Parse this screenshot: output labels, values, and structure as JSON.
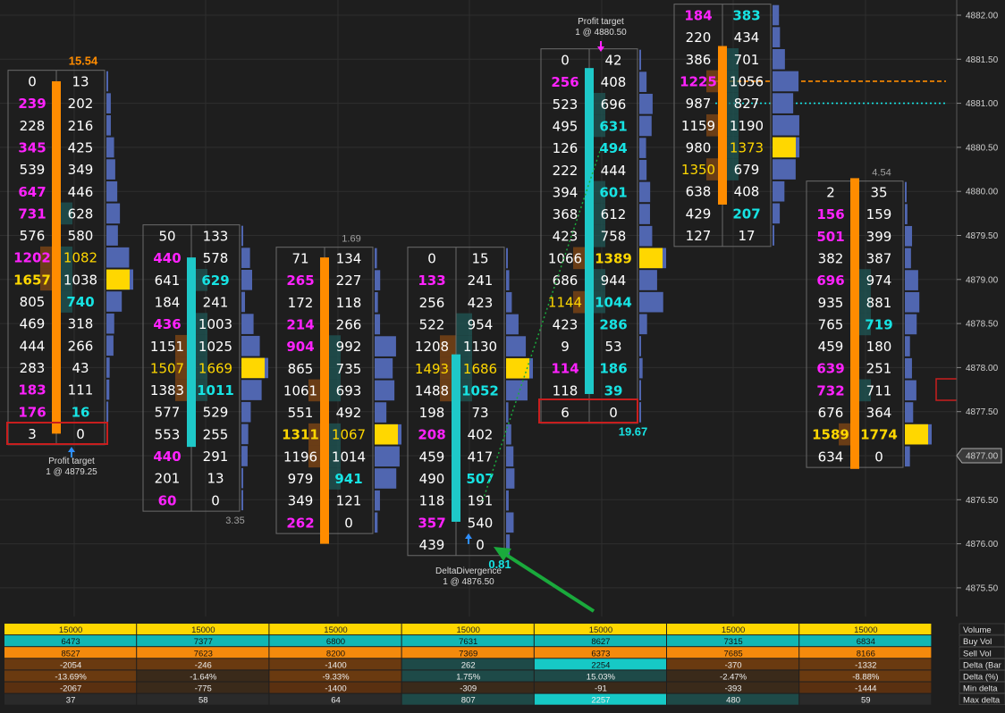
{
  "colors": {
    "background": "#1e1e1e",
    "grid": "#2e2e2e",
    "cell_border": "#6b6b6b",
    "bid_strong": "#ff22ff",
    "ask_strong": "#17e3e3",
    "poc_yellow": "#ffd700",
    "bar_orange": "#ff8c00",
    "bar_cyan": "#1ec8c8",
    "profile_blue": "#5066b0",
    "heat_orange": "#8a4a12",
    "heat_teal": "#1e5a58",
    "profit_box": "#c81e1e",
    "arrow_green": "#1aaa3c",
    "annotation_blue": "#2f8fff"
  },
  "chart_data": {
    "type": "table",
    "title": "Footprint",
    "y_axis": {
      "price_range": [
        4875.25,
        4882.0
      ],
      "tick_step": 0.5,
      "tick_labels": [
        "4882.00",
        "4881.50",
        "4881.00",
        "4880.50",
        "4880.00",
        "4879.50",
        "4879.00",
        "4878.50",
        "4878.00",
        "4877.50",
        "4877.00",
        "4876.50",
        "4876.00",
        "4875.50"
      ],
      "current_price_label": "4877.00"
    },
    "candles": [
      {
        "top_label": "15.54",
        "top_label_color": "#ff8c00",
        "bottom_label": "",
        "bar_color": "orange",
        "bar_range": [
          4877.25,
          4881.25
        ],
        "rows": [
          {
            "bid": "0",
            "ask": "13",
            "bid_c": "w",
            "ask_c": "w"
          },
          {
            "bid": "239",
            "ask": "202",
            "bid_c": "m",
            "ask_c": "w"
          },
          {
            "bid": "228",
            "ask": "216",
            "bid_c": "w",
            "ask_c": "w"
          },
          {
            "bid": "345",
            "ask": "425",
            "bid_c": "m",
            "ask_c": "w"
          },
          {
            "bid": "539",
            "ask": "349",
            "bid_c": "w",
            "ask_c": "w"
          },
          {
            "bid": "647",
            "ask": "446",
            "bid_c": "m",
            "ask_c": "w"
          },
          {
            "bid": "731",
            "ask": "628",
            "bid_c": "m",
            "ask_c": "w"
          },
          {
            "bid": "576",
            "ask": "580",
            "bid_c": "w",
            "ask_c": "w"
          },
          {
            "bid": "1202",
            "ask": "1082",
            "bid_c": "m",
            "ask_c": "y"
          },
          {
            "bid": "1657",
            "ask": "1038",
            "bid_c": "yb",
            "ask_c": "w"
          },
          {
            "bid": "805",
            "ask": "740",
            "bid_c": "w",
            "ask_c": "c"
          },
          {
            "bid": "469",
            "ask": "318",
            "bid_c": "w",
            "ask_c": "w"
          },
          {
            "bid": "444",
            "ask": "266",
            "bid_c": "w",
            "ask_c": "w"
          },
          {
            "bid": "283",
            "ask": "43",
            "bid_c": "w",
            "ask_c": "w"
          },
          {
            "bid": "183",
            "ask": "111",
            "bid_c": "m",
            "ask_c": "w"
          },
          {
            "bid": "176",
            "ask": "16",
            "bid_c": "m",
            "ask_c": "c"
          },
          {
            "bid": "3",
            "ask": "0",
            "bid_c": "w",
            "ask_c": "w"
          }
        ]
      },
      {
        "top_label": "",
        "top_label_color": "#a0a0a0",
        "bottom_label": "3.35",
        "bar_color": "cyan",
        "bar_range": [
          4877.1,
          4879.25
        ],
        "rows": [
          {
            "bid": "50",
            "ask": "133",
            "bid_c": "w",
            "ask_c": "w"
          },
          {
            "bid": "440",
            "ask": "578",
            "bid_c": "m",
            "ask_c": "w"
          },
          {
            "bid": "641",
            "ask": "629",
            "bid_c": "w",
            "ask_c": "c"
          },
          {
            "bid": "184",
            "ask": "241",
            "bid_c": "w",
            "ask_c": "w"
          },
          {
            "bid": "436",
            "ask": "1003",
            "bid_c": "m",
            "ask_c": "w"
          },
          {
            "bid": "1151",
            "ask": "1025",
            "bid_c": "w",
            "ask_c": "w"
          },
          {
            "bid": "1507",
            "ask": "1669",
            "bid_c": "y",
            "ask_c": "y"
          },
          {
            "bid": "1383",
            "ask": "1011",
            "bid_c": "w",
            "ask_c": "c"
          },
          {
            "bid": "577",
            "ask": "529",
            "bid_c": "w",
            "ask_c": "w"
          },
          {
            "bid": "553",
            "ask": "255",
            "bid_c": "w",
            "ask_c": "w"
          },
          {
            "bid": "440",
            "ask": "291",
            "bid_c": "m",
            "ask_c": "w"
          },
          {
            "bid": "201",
            "ask": "13",
            "bid_c": "w",
            "ask_c": "w"
          },
          {
            "bid": "60",
            "ask": "0",
            "bid_c": "m",
            "ask_c": "w"
          }
        ]
      },
      {
        "top_label": "1.69",
        "top_label_color": "#a0a0a0",
        "bottom_label": "",
        "bar_color": "orange",
        "bar_range": [
          4876.0,
          4879.25
        ],
        "rows": [
          {
            "bid": "71",
            "ask": "134",
            "bid_c": "w",
            "ask_c": "w"
          },
          {
            "bid": "265",
            "ask": "227",
            "bid_c": "m",
            "ask_c": "w"
          },
          {
            "bid": "172",
            "ask": "118",
            "bid_c": "w",
            "ask_c": "w"
          },
          {
            "bid": "214",
            "ask": "266",
            "bid_c": "m",
            "ask_c": "w"
          },
          {
            "bid": "904",
            "ask": "992",
            "bid_c": "m",
            "ask_c": "w"
          },
          {
            "bid": "865",
            "ask": "735",
            "bid_c": "w",
            "ask_c": "w"
          },
          {
            "bid": "1061",
            "ask": "693",
            "bid_c": "w",
            "ask_c": "w"
          },
          {
            "bid": "551",
            "ask": "492",
            "bid_c": "w",
            "ask_c": "w"
          },
          {
            "bid": "1311",
            "ask": "1067",
            "bid_c": "yb",
            "ask_c": "y"
          },
          {
            "bid": "1196",
            "ask": "1014",
            "bid_c": "w",
            "ask_c": "w"
          },
          {
            "bid": "979",
            "ask": "941",
            "bid_c": "w",
            "ask_c": "c"
          },
          {
            "bid": "349",
            "ask": "121",
            "bid_c": "w",
            "ask_c": "w"
          },
          {
            "bid": "262",
            "ask": "0",
            "bid_c": "m",
            "ask_c": "w"
          }
        ]
      },
      {
        "top_label": "",
        "top_label_color": "#a0a0a0",
        "bottom_label": "0.81",
        "bar_color": "cyan",
        "bar_range": [
          4876.25,
          4878.15
        ],
        "rows": [
          {
            "bid": "0",
            "ask": "15",
            "bid_c": "w",
            "ask_c": "w"
          },
          {
            "bid": "133",
            "ask": "241",
            "bid_c": "m",
            "ask_c": "w"
          },
          {
            "bid": "256",
            "ask": "423",
            "bid_c": "w",
            "ask_c": "w"
          },
          {
            "bid": "522",
            "ask": "954",
            "bid_c": "w",
            "ask_c": "w"
          },
          {
            "bid": "1208",
            "ask": "1130",
            "bid_c": "w",
            "ask_c": "w"
          },
          {
            "bid": "1493",
            "ask": "1686",
            "bid_c": "y",
            "ask_c": "y"
          },
          {
            "bid": "1488",
            "ask": "1052",
            "bid_c": "w",
            "ask_c": "c"
          },
          {
            "bid": "198",
            "ask": "73",
            "bid_c": "w",
            "ask_c": "w"
          },
          {
            "bid": "208",
            "ask": "402",
            "bid_c": "m",
            "ask_c": "w"
          },
          {
            "bid": "459",
            "ask": "417",
            "bid_c": "w",
            "ask_c": "w"
          },
          {
            "bid": "490",
            "ask": "507",
            "bid_c": "w",
            "ask_c": "c"
          },
          {
            "bid": "118",
            "ask": "191",
            "bid_c": "w",
            "ask_c": "w"
          },
          {
            "bid": "357",
            "ask": "540",
            "bid_c": "m",
            "ask_c": "w"
          },
          {
            "bid": "439",
            "ask": "0",
            "bid_c": "w",
            "ask_c": "w"
          }
        ]
      },
      {
        "top_label": "",
        "top_label_color": "#a0a0a0",
        "bottom_label": "19.67",
        "bar_color": "cyan",
        "bar_range": [
          4877.7,
          4881.4
        ],
        "rows": [
          {
            "bid": "0",
            "ask": "42",
            "bid_c": "w",
            "ask_c": "w"
          },
          {
            "bid": "256",
            "ask": "408",
            "bid_c": "m",
            "ask_c": "w"
          },
          {
            "bid": "523",
            "ask": "696",
            "bid_c": "w",
            "ask_c": "w"
          },
          {
            "bid": "495",
            "ask": "631",
            "bid_c": "w",
            "ask_c": "c"
          },
          {
            "bid": "126",
            "ask": "494",
            "bid_c": "w",
            "ask_c": "c"
          },
          {
            "bid": "222",
            "ask": "444",
            "bid_c": "w",
            "ask_c": "w"
          },
          {
            "bid": "394",
            "ask": "601",
            "bid_c": "w",
            "ask_c": "c"
          },
          {
            "bid": "368",
            "ask": "612",
            "bid_c": "w",
            "ask_c": "w"
          },
          {
            "bid": "423",
            "ask": "758",
            "bid_c": "w",
            "ask_c": "w"
          },
          {
            "bid": "1066",
            "ask": "1389",
            "bid_c": "w",
            "ask_c": "yb"
          },
          {
            "bid": "686",
            "ask": "944",
            "bid_c": "w",
            "ask_c": "w"
          },
          {
            "bid": "1144",
            "ask": "1044",
            "bid_c": "y",
            "ask_c": "c"
          },
          {
            "bid": "423",
            "ask": "286",
            "bid_c": "w",
            "ask_c": "c"
          },
          {
            "bid": "9",
            "ask": "53",
            "bid_c": "w",
            "ask_c": "w"
          },
          {
            "bid": "114",
            "ask": "186",
            "bid_c": "m",
            "ask_c": "c"
          },
          {
            "bid": "118",
            "ask": "39",
            "bid_c": "w",
            "ask_c": "c"
          },
          {
            "bid": "6",
            "ask": "0",
            "bid_c": "w",
            "ask_c": "w"
          }
        ]
      },
      {
        "top_label": "",
        "top_label_color": "#a0a0a0",
        "bottom_label": "",
        "bar_color": "orange",
        "bar_range": [
          4879.85,
          4881.65
        ],
        "rows": [
          {
            "bid": "184",
            "ask": "383",
            "bid_c": "m",
            "ask_c": "c"
          },
          {
            "bid": "220",
            "ask": "434",
            "bid_c": "w",
            "ask_c": "w"
          },
          {
            "bid": "386",
            "ask": "701",
            "bid_c": "w",
            "ask_c": "w"
          },
          {
            "bid": "1225",
            "ask": "1056",
            "bid_c": "m",
            "ask_c": "w"
          },
          {
            "bid": "987",
            "ask": "827",
            "bid_c": "w",
            "ask_c": "w"
          },
          {
            "bid": "1159",
            "ask": "1190",
            "bid_c": "w",
            "ask_c": "w"
          },
          {
            "bid": "980",
            "ask": "1373",
            "bid_c": "w",
            "ask_c": "y"
          },
          {
            "bid": "1350",
            "ask": "679",
            "bid_c": "y",
            "ask_c": "w"
          },
          {
            "bid": "638",
            "ask": "408",
            "bid_c": "w",
            "ask_c": "w"
          },
          {
            "bid": "429",
            "ask": "207",
            "bid_c": "w",
            "ask_c": "c"
          },
          {
            "bid": "127",
            "ask": "17",
            "bid_c": "w",
            "ask_c": "w"
          }
        ]
      },
      {
        "top_label": "4.54",
        "top_label_color": "#a0a0a0",
        "bottom_label": "",
        "bar_color": "orange",
        "bar_range": [
          4876.85,
          4880.15
        ],
        "rows": [
          {
            "bid": "2",
            "ask": "35",
            "bid_c": "w",
            "ask_c": "w"
          },
          {
            "bid": "156",
            "ask": "159",
            "bid_c": "m",
            "ask_c": "w"
          },
          {
            "bid": "501",
            "ask": "399",
            "bid_c": "m",
            "ask_c": "w"
          },
          {
            "bid": "382",
            "ask": "387",
            "bid_c": "w",
            "ask_c": "w"
          },
          {
            "bid": "696",
            "ask": "974",
            "bid_c": "m",
            "ask_c": "w"
          },
          {
            "bid": "935",
            "ask": "881",
            "bid_c": "w",
            "ask_c": "w"
          },
          {
            "bid": "765",
            "ask": "719",
            "bid_c": "w",
            "ask_c": "c"
          },
          {
            "bid": "459",
            "ask": "180",
            "bid_c": "w",
            "ask_c": "w"
          },
          {
            "bid": "639",
            "ask": "251",
            "bid_c": "m",
            "ask_c": "w"
          },
          {
            "bid": "732",
            "ask": "711",
            "bid_c": "m",
            "ask_c": "w"
          },
          {
            "bid": "676",
            "ask": "364",
            "bid_c": "w",
            "ask_c": "w"
          },
          {
            "bid": "1589",
            "ask": "1774",
            "bid_c": "yb",
            "ask_c": "yb"
          },
          {
            "bid": "634",
            "ask": "0",
            "bid_c": "w",
            "ask_c": "w"
          }
        ]
      }
    ],
    "annotations": [
      {
        "line1": "Profit target",
        "line2": "1 @ 4879.25"
      },
      {
        "line1": "Profit target",
        "line2": "1 @ 4880.50"
      },
      {
        "line1": "DeltaDivergence",
        "line2": "1 @ 4876.50"
      }
    ],
    "horizontal_lines": [
      {
        "price": 4881.25,
        "color": "#ff8c00",
        "style": "dashed"
      },
      {
        "price": 4881.0,
        "color": "#17e3e3",
        "style": "dotted"
      }
    ],
    "stats": {
      "row_labels": [
        "Volume",
        "Buy Vol",
        "Sell Vol",
        "Delta (Bar)",
        "Delta (%)",
        "Min delta",
        "Max delta"
      ],
      "row_label_display": [
        "Volume",
        "Buy Vol",
        "Sell Vol",
        "Delta (Bar",
        "Delta (%)",
        "Min delta",
        "Max delta"
      ],
      "rows": [
        [
          "15000",
          "15000",
          "15000",
          "15000",
          "15000",
          "15000",
          "15000"
        ],
        [
          "6473",
          "7377",
          "6800",
          "7631",
          "8627",
          "7315",
          "6834"
        ],
        [
          "8527",
          "7623",
          "8200",
          "7369",
          "6373",
          "7685",
          "8166"
        ],
        [
          "-2054",
          "-246",
          "-1400",
          "262",
          "2254",
          "-370",
          "-1332"
        ],
        [
          "-13.69%",
          "-1.64%",
          "-9.33%",
          "1.75%",
          "15.03%",
          "-2.47%",
          "-8.88%"
        ],
        [
          "-2067",
          "-775",
          "-1400",
          "-309",
          "-91",
          "-393",
          "-1444"
        ],
        [
          "37",
          "58",
          "64",
          "807",
          "2257",
          "480",
          "59"
        ]
      ]
    }
  }
}
